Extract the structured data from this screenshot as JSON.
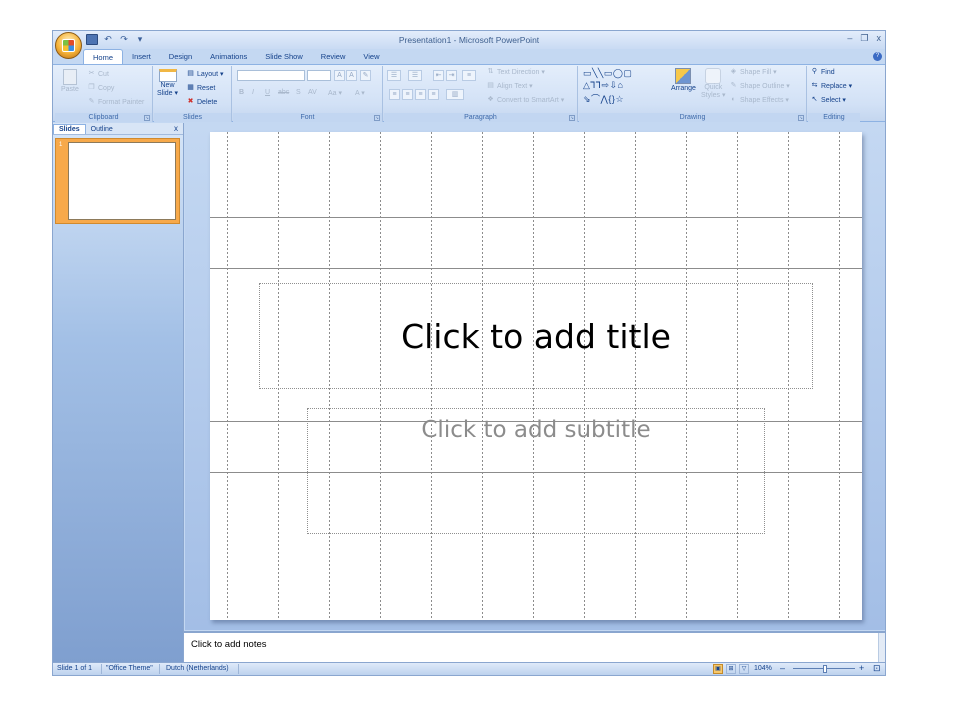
{
  "window": {
    "title": "Presentation1 - Microsoft PowerPoint",
    "minimize": "–",
    "restore": "❐",
    "close": "x"
  },
  "quick_access": {
    "undo": "↶",
    "redo": "↷",
    "customize": "▾"
  },
  "tabs": [
    "Home",
    "Insert",
    "Design",
    "Animations",
    "Slide Show",
    "Review",
    "View"
  ],
  "ribbon": {
    "clipboard": {
      "label": "Clipboard",
      "paste": "Paste",
      "cut": "Cut",
      "copy": "Copy",
      "format_painter": "Format Painter"
    },
    "slides": {
      "label": "Slides",
      "new_slide": "New",
      "new_slide_2": "Slide ▾",
      "layout": "Layout ▾",
      "reset": "Reset",
      "delete": "Delete"
    },
    "font": {
      "label": "Font",
      "grow": "A",
      "shrink": "A",
      "clear": "✎",
      "bold": "B",
      "italic": "I",
      "underline": "U",
      "strike": "abc",
      "shadow": "S",
      "spacing": "AV",
      "case": "Aa ▾",
      "color": "A ▾"
    },
    "paragraph": {
      "label": "Paragraph",
      "text_direction": "Text Direction ▾",
      "align_text": "Align Text ▾",
      "convert_smartart": "Convert to SmartArt ▾"
    },
    "drawing": {
      "label": "Drawing",
      "arrange": "Arrange",
      "quick_styles": "Quick",
      "quick_styles_2": "Styles ▾",
      "shape_fill": "Shape Fill ▾",
      "shape_outline": "Shape Outline ▾",
      "shape_effects": "Shape Effects ▾",
      "shapes_row1": "▭ ╲ ╲ ▭ ◯ ▢",
      "shapes_row2": "△ ⅂ ⅂ ⇨ ⇩ ⌂",
      "shapes_row3": "⇘ ⌒ ⋀ { } ☆"
    },
    "editing": {
      "label": "Editing",
      "find": "Find",
      "replace": "Replace ▾",
      "select": "Select ▾"
    }
  },
  "left_pane": {
    "tab_slides": "Slides",
    "tab_outline": "Outline",
    "close": "x",
    "thumb_number": "1"
  },
  "slide": {
    "title_placeholder": "Click to add title",
    "subtitle_placeholder": "Click to add subtitle"
  },
  "notes": {
    "placeholder": "Click to add notes"
  },
  "status": {
    "slide_count": "Slide 1 of 1",
    "theme": "\"Office Theme\"",
    "language": "Dutch (Netherlands)",
    "zoom": "104%",
    "zoom_out": "–",
    "zoom_in": "+",
    "fit": "⊡"
  },
  "colors": {
    "accent": "#15428b",
    "ribbon_bg": "#d2e1f6",
    "frame": "#c4d8f2",
    "thumbnail_highlight": "#f7a94a"
  }
}
